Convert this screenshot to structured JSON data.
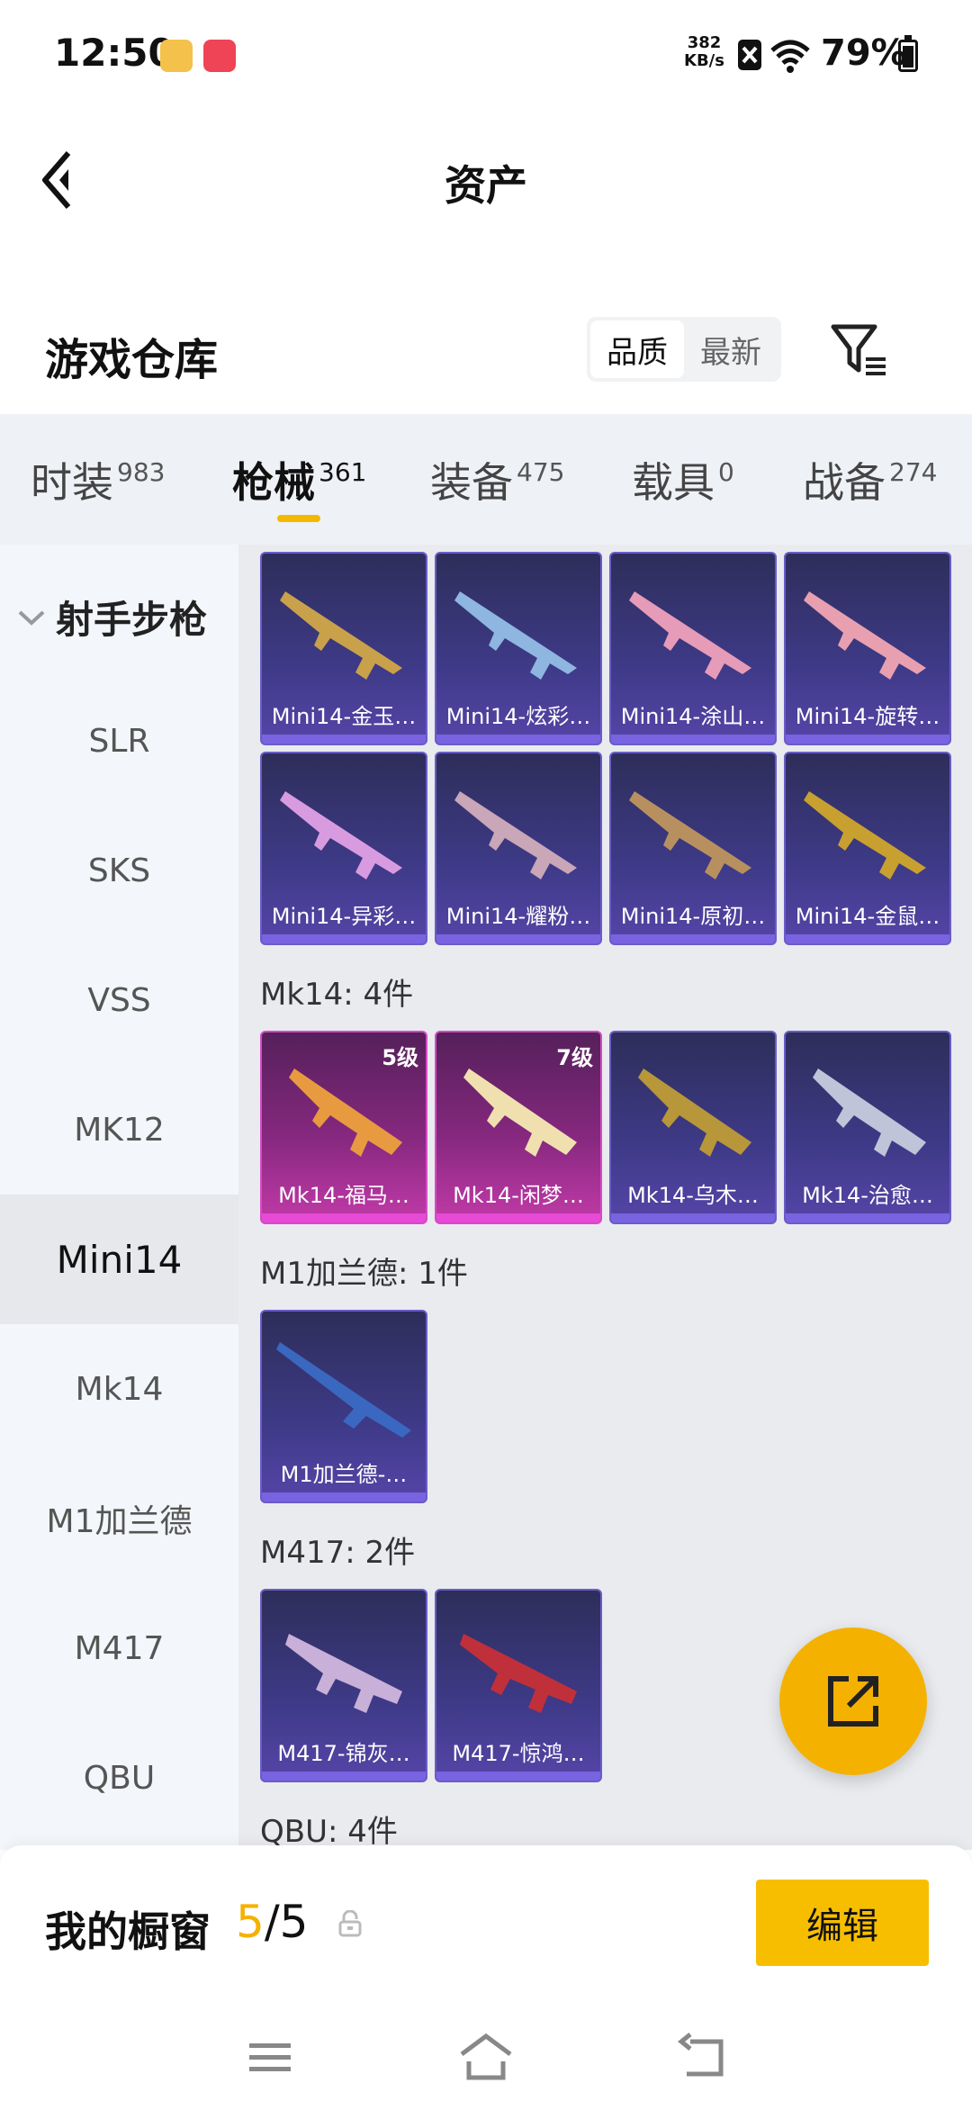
{
  "status_bar": {
    "time": "12:50",
    "speed_value": "382",
    "speed_unit": "KB/s",
    "battery": "79%"
  },
  "header": {
    "title": "资产"
  },
  "warehouse": {
    "title": "游戏仓库",
    "sort_options": [
      "品质",
      "最新"
    ],
    "sort_active": "品质"
  },
  "tabs": [
    {
      "label": "时装",
      "count": "983"
    },
    {
      "label": "枪械",
      "count": "361"
    },
    {
      "label": "装备",
      "count": "475"
    },
    {
      "label": "载具",
      "count": "0"
    },
    {
      "label": "战备",
      "count": "274"
    }
  ],
  "sidebar": {
    "group": "射手步枪",
    "items": [
      "SLR",
      "SKS",
      "VSS",
      "MK12",
      "Mini14",
      "Mk14",
      "M1加兰德",
      "M417",
      "QBU"
    ],
    "active": "Mini14"
  },
  "sections": {
    "mini14_cards": [
      "Mini14-金玉…",
      "Mini14-炫彩…",
      "Mini14-涂山…",
      "Mini14-旋转…",
      "Mini14-异彩…",
      "Mini14-耀粉…",
      "Mini14-原初…",
      "Mini14-金鼠…"
    ],
    "mk14_title": "Mk14: 4件",
    "mk14_cards": [
      "Mk14-福马…",
      "Mk14-闲梦…",
      "Mk14-乌木…",
      "Mk14-治愈…"
    ],
    "mk14_levels": [
      "5级",
      "7级"
    ],
    "m1_title": "M1加兰德: 1件",
    "m1_cards": [
      "M1加兰德-…"
    ],
    "m417_title": "M417: 2件",
    "m417_cards": [
      "M417-锦灰…",
      "M417-惊鸿…"
    ],
    "qbu_title": "QBU: 4件"
  },
  "showcase": {
    "label": "我的橱窗",
    "current": "5",
    "separator": "/",
    "max": "5",
    "edit_label": "编辑"
  },
  "colors": {
    "accent": "#f5b100",
    "epic_frame": "#6a5cc8",
    "legend_frame": "#d64ac6"
  },
  "icons": [
    "back-icon",
    "filter-icon",
    "chevron-down-icon",
    "share-icon",
    "lock-icon",
    "menu-icon",
    "home-icon",
    "back-nav-icon"
  ]
}
